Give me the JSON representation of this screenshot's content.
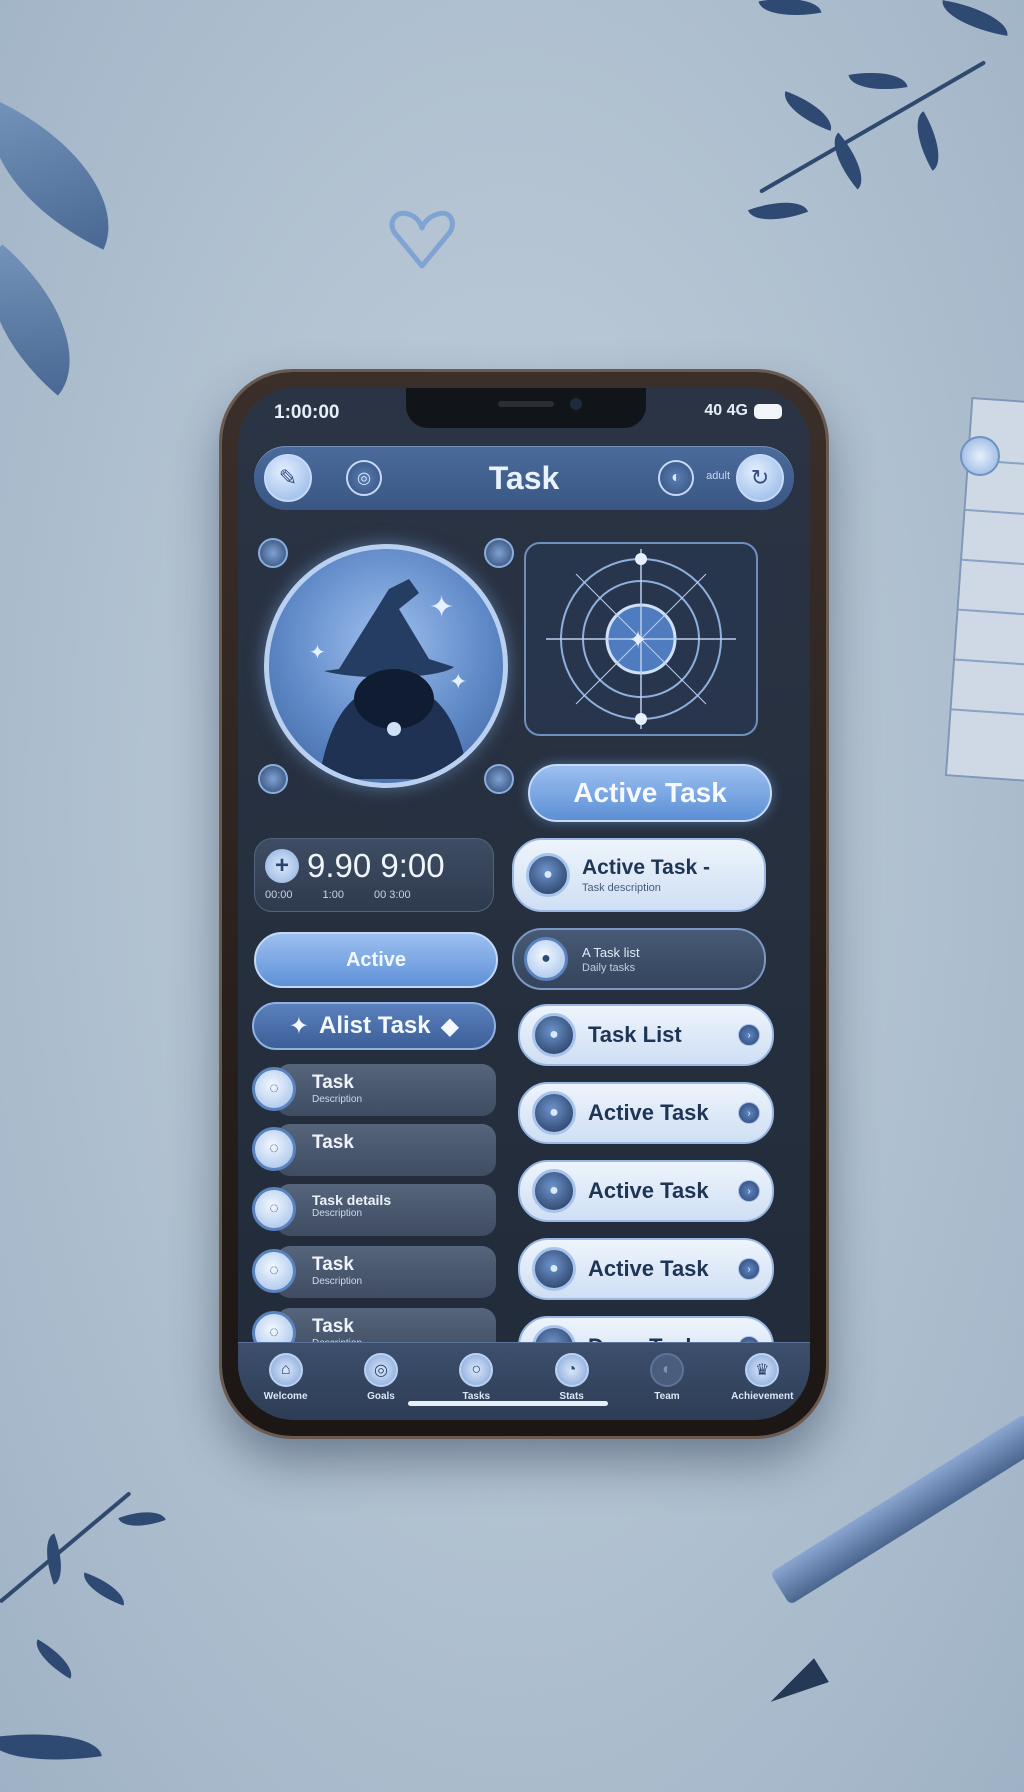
{
  "status_bar": {
    "time": "1:00:00",
    "icons": "40 4G"
  },
  "header": {
    "title": "Task",
    "subtitle": "adult",
    "left_icon": "wand-icon",
    "right_icon": "refresh-icon"
  },
  "buttons": {
    "active_task": "Active Task",
    "active": "Active"
  },
  "timer": {
    "value": "9.90 9:00",
    "sub_left": "00:00",
    "sub_mid": "1:00",
    "sub_right": "00 3:00"
  },
  "active_card": {
    "title": "Active Task -",
    "subtitle": "Task description"
  },
  "secondary_card": {
    "title": "A Task list",
    "subtitle": "Daily tasks"
  },
  "left_list": {
    "heading": "Alist Task",
    "items": [
      {
        "title": "Task",
        "subtitle": "Description"
      },
      {
        "title": "Task",
        "subtitle": ""
      },
      {
        "title": "Task details",
        "subtitle": "Description"
      },
      {
        "title": "Task",
        "subtitle": "Description"
      },
      {
        "title": "Task",
        "subtitle": "Description"
      }
    ]
  },
  "right_list": {
    "items": [
      {
        "title": "Task List"
      },
      {
        "title": "Active Task"
      },
      {
        "title": "Active Task"
      },
      {
        "title": "Active Task"
      },
      {
        "title": "Done Task"
      }
    ]
  },
  "tabbar": {
    "tabs": [
      {
        "label": "Welcome",
        "icon": "home-icon"
      },
      {
        "label": "Goals",
        "icon": "target-icon"
      },
      {
        "label": "Tasks",
        "icon": "circle-icon"
      },
      {
        "label": "Stats",
        "icon": "chart-icon"
      },
      {
        "label": "Team",
        "icon": "team-icon"
      },
      {
        "label": "Achievement",
        "icon": "trophy-icon"
      }
    ]
  },
  "colors": {
    "accent": "#5d8fd6",
    "background": "#aebfcf",
    "screen": "#222b39"
  }
}
